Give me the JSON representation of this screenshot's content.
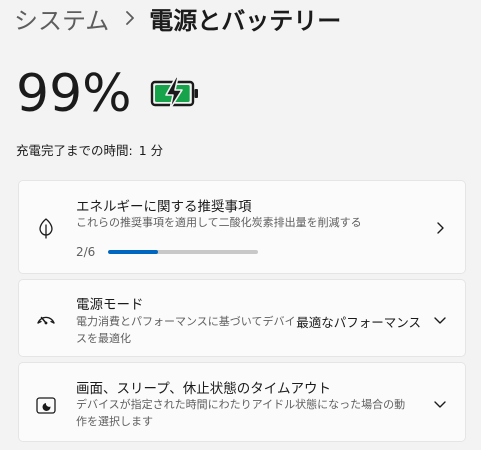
{
  "breadcrumb": {
    "parent": "システム",
    "current": "電源とバッテリー"
  },
  "battery": {
    "percent_text": "99%",
    "level": 0.99,
    "charging": true,
    "icon": "battery-charging-icon",
    "color": "#16a34a",
    "time_label": "充電完了までの時間:",
    "time_value": "1 分"
  },
  "cards": {
    "energy": {
      "icon": "leaf-icon",
      "title": "エネルギーに関する推奨事項",
      "description": "これらの推奨事項を適用して二酸化炭素排出量を削減する",
      "progress_text": "2/6",
      "progress_value": 0.333,
      "chevron": "chevron-right-icon"
    },
    "power_mode": {
      "icon": "gauge-icon",
      "title": "電源モード",
      "description": "電力消費とパフォーマンスに基づいてデバイスを最適化",
      "selected_value": "最適なパフォーマンス",
      "chevron": "chevron-down-icon"
    },
    "sleep": {
      "icon": "screen-sleep-icon",
      "title": "画面、スリープ、休止状態のタイムアウト",
      "description": "デバイスが指定された時間にわたりアイドル状態になった場合の動作を選択します",
      "chevron": "chevron-down-icon"
    }
  },
  "colors": {
    "accent": "#0067c0",
    "background": "#f3f3f3",
    "card": "#fbfbfb"
  }
}
